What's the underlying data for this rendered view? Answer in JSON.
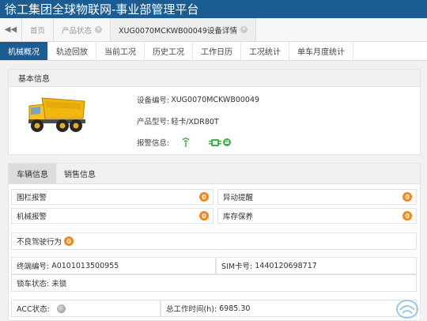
{
  "app": {
    "title": "徐工集团全球物联网-事业部管理平台"
  },
  "tabs": [
    {
      "label": "首页",
      "closable": false
    },
    {
      "label": "产品状态",
      "closable": true
    },
    {
      "label": "XUG0070MCKWB00049设备详情",
      "closable": true
    }
  ],
  "subtabs": [
    "机械概况",
    "轨迹回放",
    "当前工况",
    "历史工况",
    "工作日历",
    "工况统计",
    "单车月度统计"
  ],
  "basic": {
    "header": "基本信息",
    "device_no_label": "设备编号:",
    "device_no": "XUG0070MCKWB00049",
    "model_label": "产品型号:",
    "model": "轻卡/XDR80T",
    "alarm_label": "报警信息:"
  },
  "vehicle": {
    "tabs": [
      "车辆信息",
      "销售信息"
    ],
    "alarms": [
      {
        "label": "围栏报警",
        "count": "0"
      },
      {
        "label": "异动提醒",
        "count": "0"
      },
      {
        "label": "机械报警",
        "count": "0"
      },
      {
        "label": "库存保养",
        "count": "0"
      }
    ],
    "bad_driving_label": "不良驾驶行为",
    "bad_driving_count": "0",
    "terminal_label": "终端编号:",
    "terminal": "A0101013500955",
    "sim_label": "SIM卡号:",
    "sim": "1440120698717",
    "lock_label": "锁车状态:",
    "lock": "未锁",
    "acc_label": "ACC状态:",
    "total_hours_label": "总工作时间(h):",
    "total_hours": "6985.30"
  },
  "colors": {
    "primary": "#1b5d93",
    "badge": "#f08a1c",
    "signal": "#3bb34a"
  }
}
